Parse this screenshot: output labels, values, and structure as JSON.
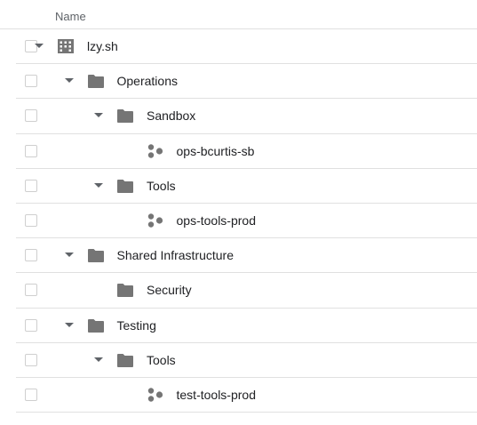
{
  "header": {
    "name_label": "Name"
  },
  "colors": {
    "icon": "#757575",
    "caret": "#5f6368",
    "divider": "#e0e0e0",
    "checkbox_border": "#cfcfcf",
    "text": "#202124",
    "header_text": "#5f6368"
  },
  "tree": [
    {
      "label": "lzy.sh",
      "icon": "organization-icon",
      "expanded": true,
      "depth": 0
    },
    {
      "label": "Operations",
      "icon": "folder-icon",
      "expanded": true,
      "depth": 1
    },
    {
      "label": "Sandbox",
      "icon": "folder-icon",
      "expanded": true,
      "depth": 2
    },
    {
      "label": "ops-bcurtis-sb",
      "icon": "project-icon",
      "expanded": null,
      "depth": 3
    },
    {
      "label": "Tools",
      "icon": "folder-icon",
      "expanded": true,
      "depth": 2
    },
    {
      "label": "ops-tools-prod",
      "icon": "project-icon",
      "expanded": null,
      "depth": 3
    },
    {
      "label": "Shared Infrastructure",
      "icon": "folder-icon",
      "expanded": true,
      "depth": 1
    },
    {
      "label": "Security",
      "icon": "folder-icon",
      "expanded": null,
      "depth": 2
    },
    {
      "label": "Testing",
      "icon": "folder-icon",
      "expanded": true,
      "depth": 1
    },
    {
      "label": "Tools",
      "icon": "folder-icon",
      "expanded": true,
      "depth": 2
    },
    {
      "label": "test-tools-prod",
      "icon": "project-icon",
      "expanded": null,
      "depth": 3
    }
  ]
}
